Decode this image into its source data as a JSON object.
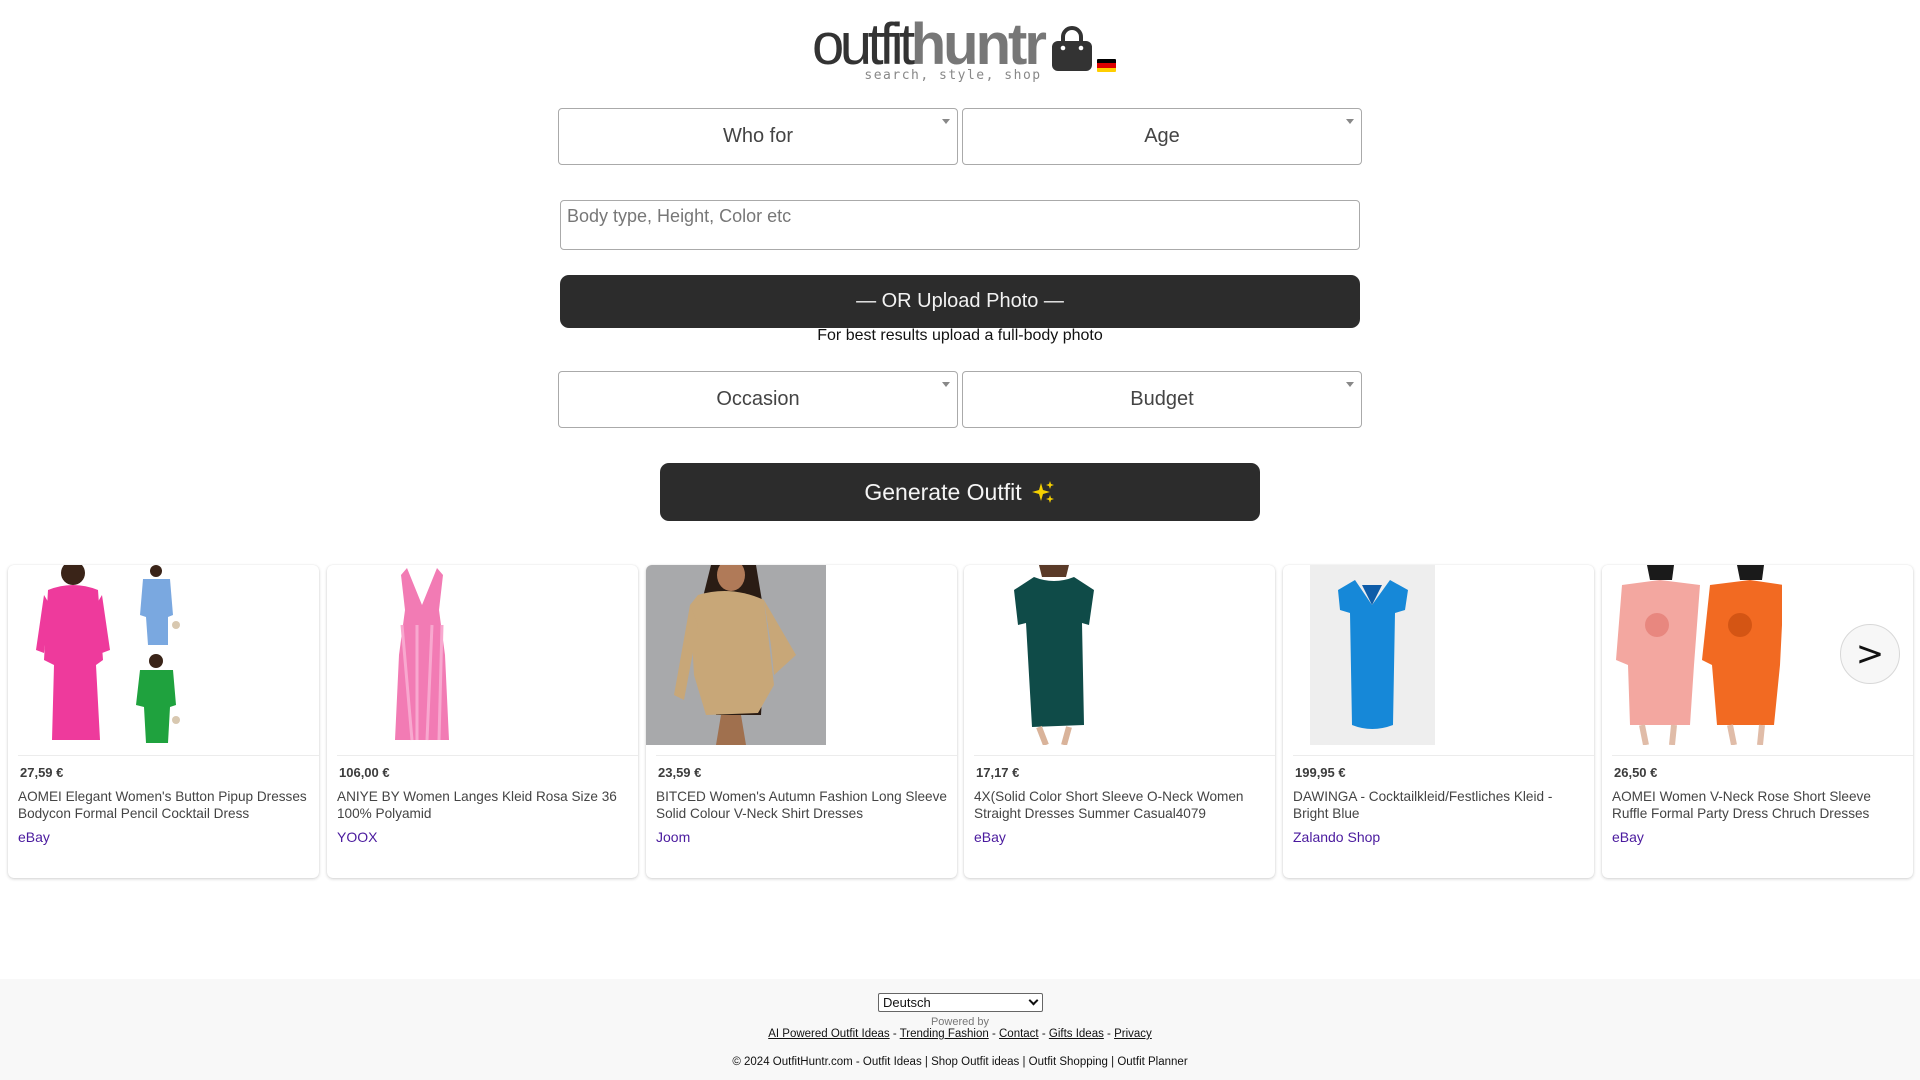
{
  "header": {
    "logo_part1": "outfit",
    "logo_part2": "huntr",
    "tagline": "search, style, shop",
    "logo_icon": "shopping-bag-icon",
    "flag_icon": "germany-flag-icon",
    "flag_colors": [
      "#000000",
      "#dd0000",
      "#ffce00"
    ]
  },
  "form": {
    "who_for": {
      "value": "Who for",
      "icon": "caret-down-icon"
    },
    "age": {
      "value": "Age",
      "icon": "caret-down-icon"
    },
    "details": {
      "placeholder": "Body type, Height, Color etc",
      "value": ""
    },
    "upload_button": "— OR Upload Photo —",
    "upload_hint": "For best results upload a full-body photo",
    "occasion": {
      "value": "Occasion",
      "icon": "caret-down-icon"
    },
    "budget": {
      "value": "Budget",
      "icon": "caret-down-icon"
    },
    "generate_button": "Generate Outfit",
    "generate_icon": "sparkles-icon"
  },
  "colors": {
    "button_bg": "#2c2c2c",
    "store_link": "#4a1a9e",
    "footer_bg": "#f8f8f8"
  },
  "products": [
    {
      "price": "27,59 €",
      "title": "AOMEI Elegant Women's Button Pipup Dresses Bodycon Formal Pencil Cocktail Dress",
      "store": "eBay",
      "image": "pink-blue-green-peplum-dresses"
    },
    {
      "price": "106,00 €",
      "title": "ANIYE BY Women Langes Kleid Rosa Size 36 100% Polyamid",
      "store": "YOOX",
      "image": "pink-ruffle-long-dress"
    },
    {
      "price": "23,59 €",
      "title": "BITCED Women's Autumn Fashion Long Sleeve Solid Colour V-Neck Shirt Dresses",
      "store": "Joom",
      "image": "beige-shirt-dress"
    },
    {
      "price": "17,17 €",
      "title": "4X(Solid Color Short Sleeve O-Neck Women Straight Dresses Summer Casual4079",
      "store": "eBay",
      "image": "teal-tshirt-dress"
    },
    {
      "price": "199,95 €",
      "title": "DAWINGA - Cocktailkleid/Festliches Kleid - Bright Blue",
      "store": "Zalando Shop",
      "image": "bright-blue-midi-dress"
    },
    {
      "price": "26,50 €",
      "title": "AOMEI Women V-Neck Rose Short Sleeve Ruffle Formal Party Dress Chruch Dresses",
      "store": "eBay",
      "image": "pink-orange-rose-dresses"
    }
  ],
  "carousel": {
    "next_label": ">"
  },
  "footer": {
    "language": "Deutsch",
    "powered_by": "Powered by",
    "links": [
      "AI Powered Outfit Ideas",
      "Trending Fashion",
      "Contact",
      "Gifts Ideas",
      "Privacy"
    ],
    "separator": " - ",
    "copyright": "© 2024 OutfitHuntr.com - Outfit Ideas | Shop Outfit ideas | Outfit Shopping | Outfit Planner"
  }
}
